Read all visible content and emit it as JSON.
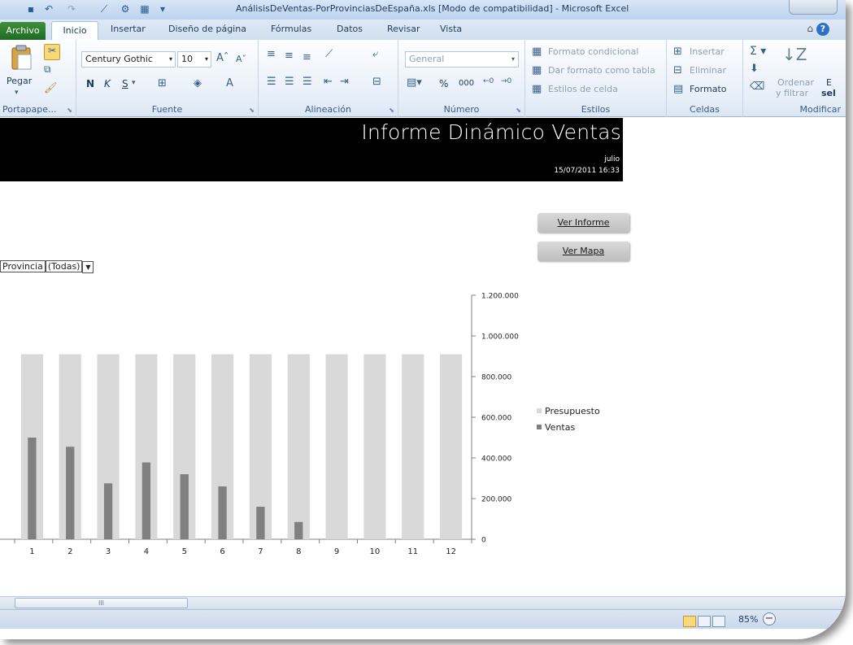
{
  "window": {
    "title": "AnálisisDeVentas-PorProvinciasDeEspaña.xls  [Modo de compatibilidad] - Microsoft Excel"
  },
  "tabs": [
    {
      "label": "Archivo"
    },
    {
      "label": "Inicio"
    },
    {
      "label": "Insertar"
    },
    {
      "label": "Diseño de página"
    },
    {
      "label": "Fórmulas"
    },
    {
      "label": "Datos"
    },
    {
      "label": "Revisar"
    },
    {
      "label": "Vista"
    }
  ],
  "ribbon": {
    "portapapeles": {
      "label": "Portapape...",
      "paste_label": "Pegar"
    },
    "fuente": {
      "label": "Fuente",
      "font_name": "Century Gothic",
      "font_size": "10",
      "bold": "N",
      "italic": "K",
      "underline": "S"
    },
    "alineacion": {
      "label": "Alineación"
    },
    "numero": {
      "label": "Número",
      "format": "General",
      "percent": "%",
      "thousands": "000"
    },
    "estilos": {
      "label": "Estilos",
      "conditional": "Formato condicional",
      "as_table": "Dar formato como tabla",
      "cell_styles": "Estilos de celda"
    },
    "celdas": {
      "label": "Celdas",
      "insert": "Insertar",
      "delete": "Eliminar",
      "format": "Formato"
    },
    "modificar": {
      "label": "Modificar",
      "sort": "Ordenar",
      "filter": "y filtrar",
      "sel_partial": "E",
      "sel_partial2": "sel"
    }
  },
  "sheet": {
    "banner_title": "Informe Dinámico Ventas",
    "month": "julio",
    "date": "15/07/2011  16:33",
    "btn_informe": "Ver Informe",
    "btn_mapa": "Ver Mapa",
    "filter_label": "Provincia",
    "filter_value": "(Todas)"
  },
  "chart_data": {
    "type": "bar",
    "categories": [
      "1",
      "2",
      "3",
      "4",
      "5",
      "6",
      "7",
      "8",
      "9",
      "10",
      "11",
      "12"
    ],
    "series": [
      {
        "name": "Presupuesto",
        "color": "#d9d9d9",
        "values": [
          910000,
          910000,
          910000,
          910000,
          910000,
          910000,
          910000,
          910000,
          910000,
          910000,
          910000,
          910000
        ]
      },
      {
        "name": "Ventas",
        "color": "#808080",
        "values": [
          500000,
          455000,
          275000,
          378000,
          320000,
          260000,
          160000,
          85000,
          0,
          0,
          0,
          0
        ]
      }
    ],
    "ylim": [
      0,
      1200000
    ],
    "yticks": [
      "0",
      "200.000",
      "400.000",
      "600.000",
      "800.000",
      "1.000.000",
      "1.200.000"
    ],
    "ytick_values": [
      0,
      200000,
      400000,
      600000,
      800000,
      1000000,
      1200000
    ],
    "y_axis_side": "right",
    "legend_position": "right",
    "grid": false
  },
  "status": {
    "zoom": "85%"
  }
}
